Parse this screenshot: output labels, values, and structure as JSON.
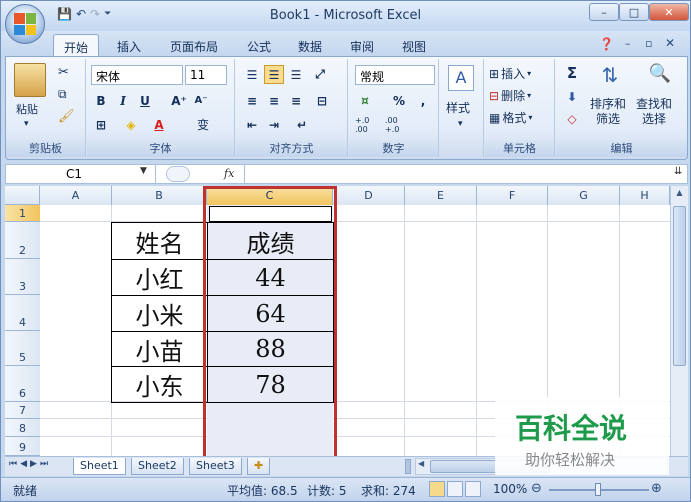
{
  "window": {
    "title": "Book1 - Microsoft Excel",
    "minimize": "–",
    "restore": "□",
    "close": "✕"
  },
  "qat": [
    "💾",
    "↶",
    "↷",
    "⏷"
  ],
  "tabs": [
    "开始",
    "插入",
    "页面布局",
    "公式",
    "数据",
    "审阅",
    "视图"
  ],
  "ribbon": {
    "clipboard": {
      "paste": "粘贴",
      "label": "剪贴板"
    },
    "font": {
      "name": "宋体",
      "size": "11",
      "bold": "B",
      "italic": "I",
      "underline": "U",
      "grow": "A⁺",
      "shrink": "A⁻",
      "phonetic": "变",
      "label": "字体"
    },
    "alignment": {
      "label": "对齐方式"
    },
    "number": {
      "format": "常规",
      "percent": "%",
      "comma": ",",
      "inc": "+.0 .00",
      "dec": ".00 +.0",
      "label": "数字"
    },
    "styles": {
      "label": "样式"
    },
    "cells": {
      "insert": "插入",
      "delete": "删除",
      "format": "格式",
      "label": "单元格"
    },
    "editing": {
      "sigma": "Σ",
      "sort": "排序和\n筛选",
      "find": "查找和\n选择",
      "label": "编辑"
    }
  },
  "formula_bar": {
    "name_box": "C1",
    "fx": "fx",
    "value": ""
  },
  "columns": [
    "A",
    "B",
    "C",
    "D",
    "E",
    "F",
    "G",
    "H"
  ],
  "rows": [
    "1",
    "2",
    "3",
    "4",
    "5",
    "6",
    "7",
    "8",
    "9"
  ],
  "table": {
    "header": [
      "姓名",
      "成绩"
    ],
    "rows": [
      {
        "name": "小红",
        "score": "44"
      },
      {
        "name": "小米",
        "score": "64"
      },
      {
        "name": "小苗",
        "score": "88"
      },
      {
        "name": "小东",
        "score": "78"
      }
    ]
  },
  "sheets": [
    "Sheet1",
    "Sheet2",
    "Sheet3"
  ],
  "status": {
    "ready": "就绪",
    "average": "平均值: 68.5",
    "count": "计数: 5",
    "sum": "求和: 274",
    "zoom": "100%"
  },
  "watermark": {
    "title": "百科全说",
    "subtitle": "助你轻松解决"
  },
  "colors": {
    "selection_border": "#c0322f",
    "selection_fill": "#e8ecf6",
    "accent": "#1d9b4b"
  }
}
